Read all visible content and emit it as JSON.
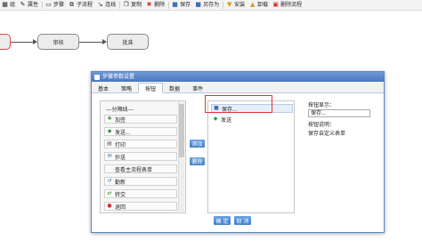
{
  "toolbar": {
    "items": [
      {
        "icon": "grid-icon",
        "label": "组"
      },
      {
        "icon": "property-icon",
        "label": "属性"
      },
      {
        "icon": "step-icon",
        "label": "步骤"
      },
      {
        "icon": "subflow-icon",
        "label": "子流程"
      },
      {
        "icon": "connect-icon",
        "label": "连线"
      },
      {
        "icon": "copy-icon",
        "label": "复制"
      },
      {
        "icon": "delete-icon",
        "label": "删除"
      },
      {
        "icon": "save-icon",
        "label": "保存"
      },
      {
        "icon": "save-as-icon",
        "label": "另存为"
      },
      {
        "icon": "install-icon",
        "label": "安装"
      },
      {
        "icon": "uninstall-icon",
        "label": "卸载"
      },
      {
        "icon": "delete-flow-icon",
        "label": "删除流程"
      }
    ]
  },
  "canvas": {
    "nodes": {
      "review": "审核",
      "approve": "批准"
    }
  },
  "dialog": {
    "title": "步骤参数设置",
    "tabs": [
      "基本",
      "策略",
      "按钮",
      "数据",
      "事件"
    ],
    "active_tab": "按钮",
    "left_buttons": [
      {
        "icon": "",
        "label": "---分隔线---"
      },
      {
        "icon": "plus-icon",
        "label": "加签"
      },
      {
        "icon": "send-icon",
        "label": "发送..."
      },
      {
        "icon": "print-icon",
        "label": "打印"
      },
      {
        "icon": "cc-icon",
        "label": "抄送"
      },
      {
        "icon": "",
        "label": "查看主流程表单"
      },
      {
        "icon": "back-icon",
        "label": "勤新"
      },
      {
        "icon": "transfer-icon",
        "label": "转交"
      },
      {
        "icon": "return-icon",
        "label": "退回"
      }
    ],
    "add_label": "添加",
    "remove_label": "删除",
    "selected_buttons": [
      {
        "icon": "save-icon",
        "label": "保存..."
      },
      {
        "icon": "send-icon",
        "label": "发送"
      }
    ],
    "display_label": "按钮显示：",
    "display_value": "保存...",
    "desc_label": "按钮说明：",
    "desc_value": "保存自定义表单",
    "confirm_label": "确 定",
    "cancel_label": "取 消"
  },
  "colors": {
    "accent": "#3d7cc8",
    "title_bar": "#4a77bf",
    "highlight": "#e23434"
  }
}
